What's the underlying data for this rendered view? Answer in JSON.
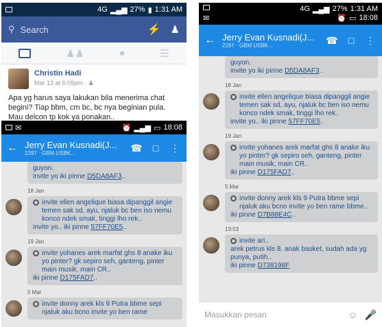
{
  "left": {
    "status": {
      "time": "1:31 AM",
      "battery": "27%",
      "network": "4G"
    },
    "fb": {
      "search_placeholder": "Search",
      "post": {
        "author": "Christin Hadi",
        "meta": "Mar 13 at 6:09pm ·",
        "text": "Apa yg harus saya lakukan bila menerima chat begini? Tiap bbm, cm bc, bc nya beginian pula. Mau delcon tp kok ya ponakan.."
      }
    },
    "chat_status": {
      "time": "18:08"
    },
    "chat": {
      "name": "Jerry Evan Kusnadi(J...",
      "sub": "229† · GBM USBK...",
      "messages": [
        {
          "date": "",
          "lines": [
            "guyon.",
            "invite yo iki pinne "
          ],
          "pin": "D5DA8AF3",
          "tail": ".."
        },
        {
          "date": "18 Jan",
          "lines": [
            "invite ellen angelique biasa dipanggil angie temen sak sd, ayu, njaluk bc ben iso nemu konco ndek smak, tinggi lho rek..",
            "invite yo.. iki pinne "
          ],
          "pin": "57FF70E5",
          "tail": ".."
        },
        {
          "date": "19 Jan",
          "lines": [
            "invite yohanes arek marfat ghs 8 anake iku yo pinter? gk sepiro seh, ganteng, pinter main musik, main CR..",
            "iki pinne "
          ],
          "pin": "D175FAD7",
          "tail": ".."
        },
        {
          "date": "5 Mar",
          "lines": [
            "invite donny arek kls 9 Putra bbme sepi njaluk aku bcno invite yo ben rame"
          ],
          "pin": "",
          "tail": ""
        }
      ]
    }
  },
  "right": {
    "status": {
      "time": "1:31 AM",
      "battery": "27%",
      "network": "4G",
      "time2": "18:08"
    },
    "chat": {
      "name": "Jerry Evan Kusnadi(J...",
      "sub": "229† · GBM USBK...",
      "input_placeholder": "Masukkan pesan",
      "messages": [
        {
          "date": "",
          "lines": [
            "guyon.",
            "invite yo iki pinne "
          ],
          "pin": "D5DA8AF3",
          "tail": ".."
        },
        {
          "date": "18 Jan",
          "lines": [
            "invite ellen angelique biasa dipanggil angie temen sak sd, ayu, njaluk bc ben iso nemu konco ndek smak, tinggi lho rek..",
            "invite yo.. iki pinne "
          ],
          "pin": "57FF70E5",
          "tail": ".."
        },
        {
          "date": "19 Jan",
          "lines": [
            "invite yohanes arek marfat ghs 8 anake iku yo pinter? gk sepiro seh, ganteng, pinter main musik, main CR..",
            "iki pinne "
          ],
          "pin": "D175FAD7",
          "tail": ".."
        },
        {
          "date": "5 Mar",
          "lines": [
            "invite donny arek kls 9 Putra bbme sepi njaluk aku bcno invite yo ben rame bbme..",
            "iki pinne "
          ],
          "pin": "D7B88E4C",
          "tail": ".."
        },
        {
          "date": "13:53",
          "lines": [
            "invite ari..",
            "arek petrus kls 8, anak basket, sudah ada yg punya, putih..",
            "iki pinne "
          ],
          "pin": "D738198F",
          "tail": ""
        }
      ]
    }
  }
}
